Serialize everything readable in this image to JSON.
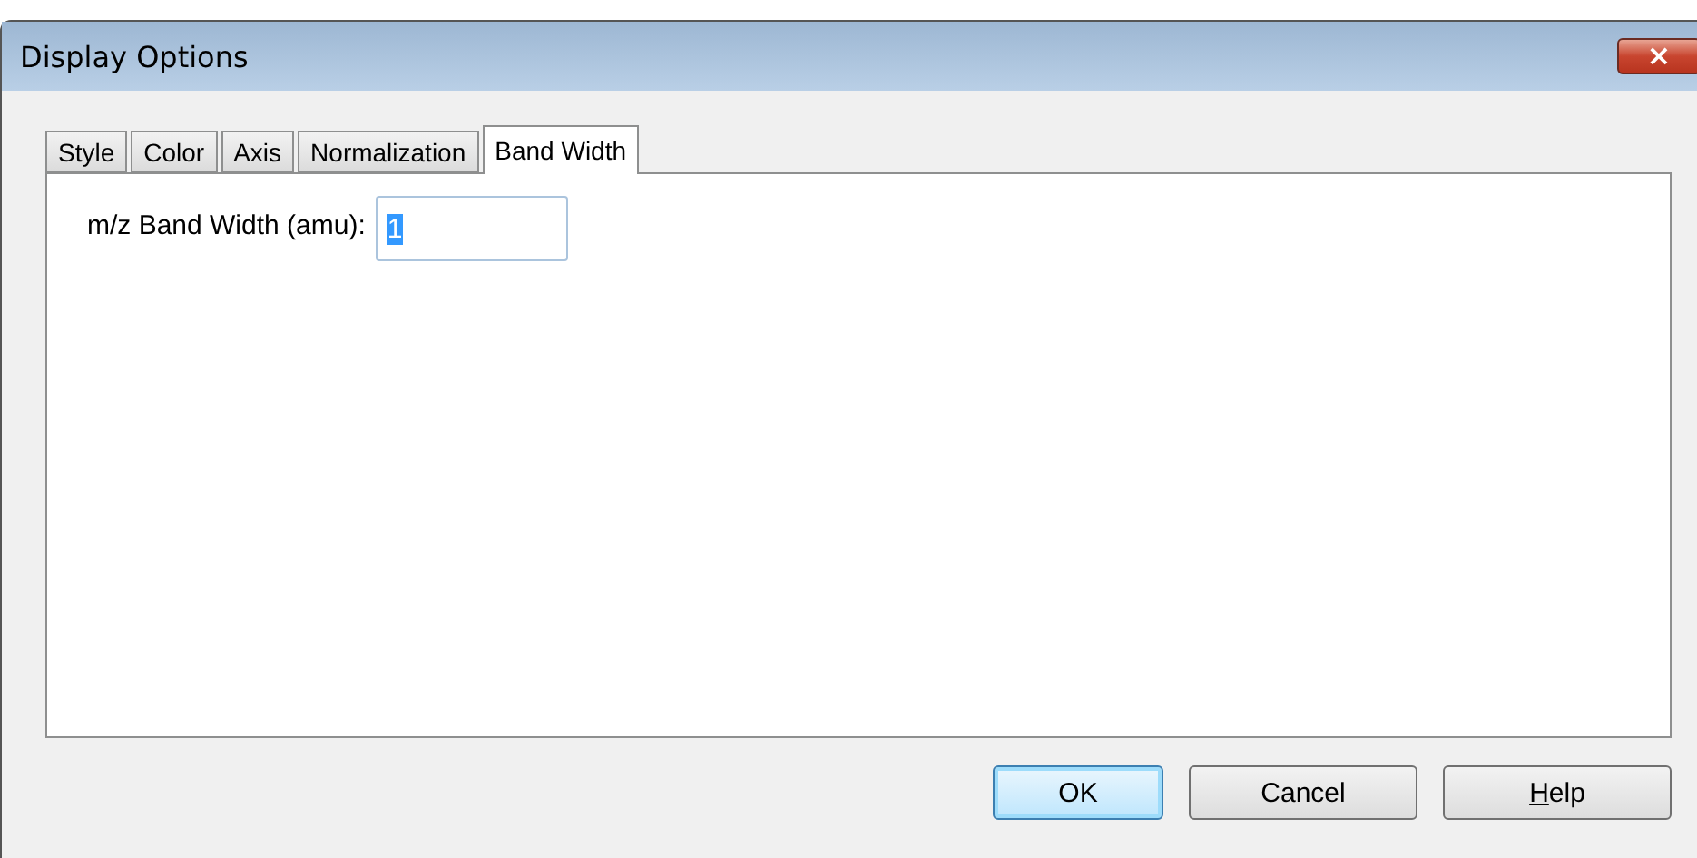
{
  "window": {
    "title": "Display Options",
    "close_label": "×"
  },
  "tabs": [
    {
      "label": "Style",
      "selected": false
    },
    {
      "label": "Color",
      "selected": false
    },
    {
      "label": "Axis",
      "selected": false
    },
    {
      "label": "Normalization",
      "selected": false
    },
    {
      "label": "Band Width",
      "selected": true
    }
  ],
  "field": {
    "label": "m/z Band Width (amu):",
    "value": "1",
    "text_selected": true
  },
  "buttons": [
    {
      "label": "OK",
      "default": true,
      "first_letter_underlined": false
    },
    {
      "label": "Cancel",
      "default": false,
      "first_letter_underlined": false
    },
    {
      "label": "Help",
      "default": false,
      "first_letter_underlined": true
    }
  ]
}
